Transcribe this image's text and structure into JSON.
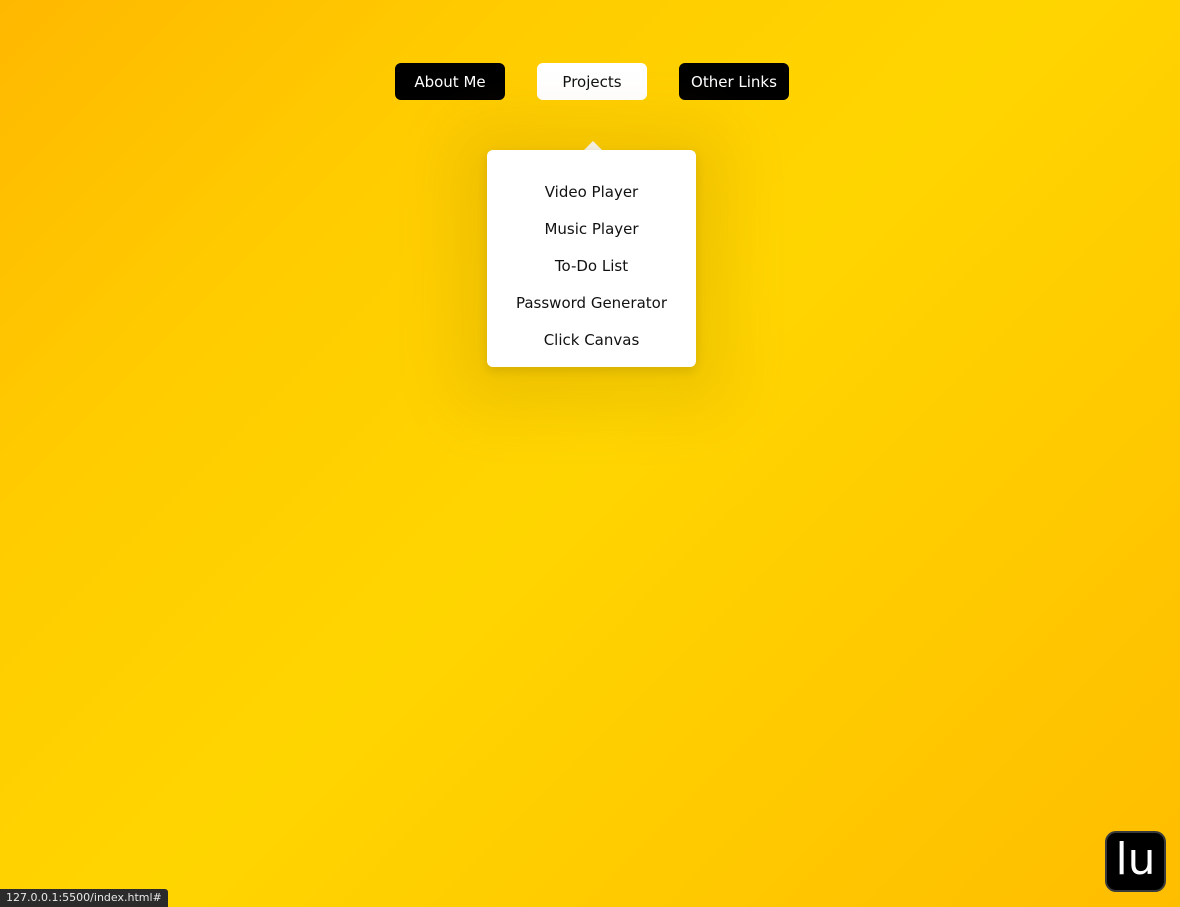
{
  "nav": {
    "about_label": "About Me",
    "projects_label": "Projects",
    "other_label": "Other Links"
  },
  "projects_menu": {
    "items": [
      "Video Player",
      "Music Player",
      "To-Do List",
      "Password Generator",
      "Click Canvas"
    ]
  },
  "logo": {
    "text": "lu"
  },
  "status_bar": {
    "url": "127.0.0.1:5500/index.html#"
  },
  "colors": {
    "background_start": "#ffb800",
    "background_mid": "#ffd500",
    "button_dark": "#000000",
    "button_active": "#ffffff"
  }
}
